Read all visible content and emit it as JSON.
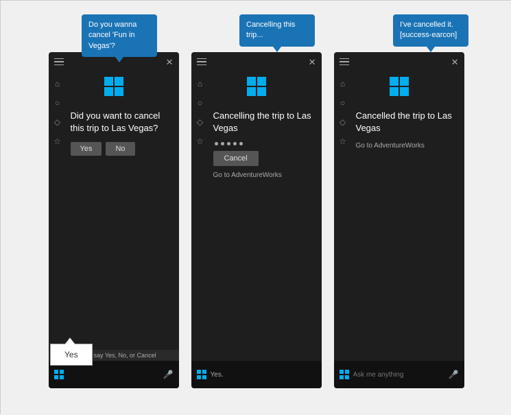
{
  "page": {
    "background": "#f0f0f0"
  },
  "bubbles": {
    "bubble1": "Do you wanna cancel 'Fun in Vegas'?",
    "bubble2": "Cancelling this trip...",
    "bubble3": "I've cancelled it. [success-earcon]"
  },
  "yes_box": {
    "label": "Yes"
  },
  "panel1": {
    "title": "Did you want to cancel this trip to Las Vegas?",
    "yes_btn": "Yes",
    "no_btn": "No",
    "hint": "you can say Yes, No, or Cancel",
    "bottom_placeholder": ""
  },
  "panel2": {
    "title": "Cancelling the trip to Las Vegas",
    "cancel_btn": "Cancel",
    "link": "Go to AdventureWorks",
    "bottom_text": "Yes."
  },
  "panel3": {
    "title": "Cancelled the trip to Las Vegas",
    "link": "Go to AdventureWorks",
    "bottom_placeholder": "Ask me anything"
  },
  "icons": {
    "hamburger": "☰",
    "close": "✕",
    "home": "⌂",
    "search": "○",
    "pin": "◇",
    "settings": "☆",
    "mic": "🎤"
  }
}
